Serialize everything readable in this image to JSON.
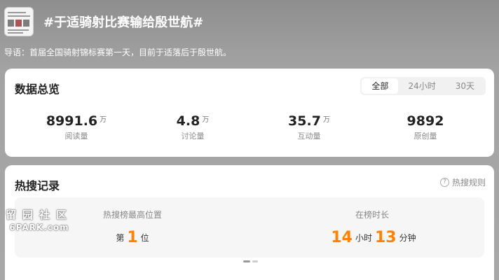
{
  "header": {
    "title": "#于适骑射比赛输给殷世航#",
    "guide": "导语：首届全国骑射锦标赛第一天，目前于适落后于殷世航。"
  },
  "overview": {
    "title": "数据总览",
    "tabs": [
      {
        "label": "全部",
        "active": true
      },
      {
        "label": "24小时",
        "active": false
      },
      {
        "label": "30天",
        "active": false
      }
    ],
    "stats": [
      {
        "value": "8991.6",
        "unit": "万",
        "label": "阅读量"
      },
      {
        "value": "4.8",
        "unit": "万",
        "label": "讨论量"
      },
      {
        "value": "35.7",
        "unit": "万",
        "label": "互动量"
      },
      {
        "value": "9892",
        "unit": "",
        "label": "原创量"
      }
    ]
  },
  "hot_search": {
    "title": "热搜记录",
    "rules_label": "热搜规则",
    "rules_icon": "question-circle-icon",
    "highest": {
      "label": "热搜榜最高位置",
      "prefix": "第",
      "value": "1",
      "suffix": "位"
    },
    "duration": {
      "label": "在榜时长",
      "hours": "14",
      "hours_unit": "小时",
      "minutes": "13",
      "minutes_unit": "分钟"
    }
  },
  "watermark": {
    "line1": "留园社区",
    "line2": "6PARK.com"
  },
  "colors": {
    "accent": "#ff8200",
    "card": "#ffffff",
    "panel": "#f6f6f6"
  }
}
